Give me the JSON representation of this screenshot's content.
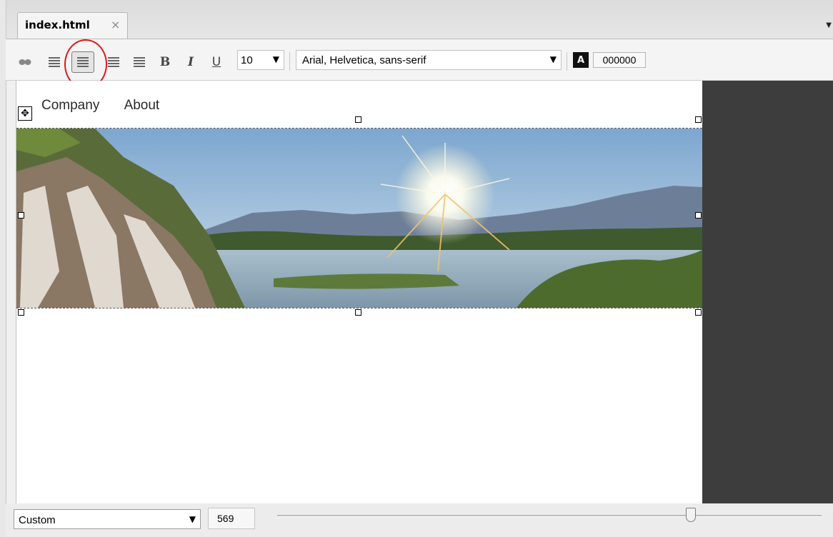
{
  "tab": {
    "label": "index.html",
    "close_symbol": "×"
  },
  "toolbar": {
    "bold_label": "B",
    "italic_label": "I",
    "underline_label": "U",
    "font_size": "10",
    "font_family": "Arial, Helvetica, sans-serif",
    "text_color_letter": "A",
    "text_color_value": "000000",
    "highlight_color": "#d81a1a"
  },
  "page": {
    "nav_items": [
      "Company",
      "About"
    ]
  },
  "footer": {
    "preset": "Custom",
    "width_value": "569",
    "slider_level": 0.77
  }
}
